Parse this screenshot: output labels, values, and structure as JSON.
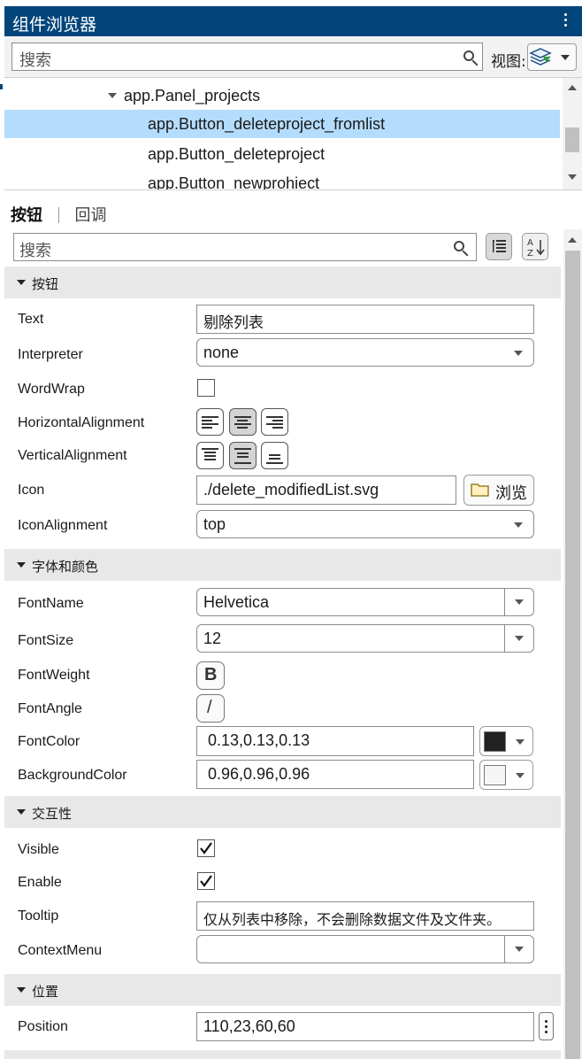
{
  "window": {
    "title": "组件浏览器"
  },
  "top_search": {
    "placeholder": "搜索"
  },
  "view": {
    "label": "视图:"
  },
  "tree": {
    "items": [
      {
        "label": "app.Panel_projects",
        "expanded": true
      },
      {
        "label": "app.Button_deleteproject_fromlist",
        "selected": true
      },
      {
        "label": "app.Button_deleteproject"
      },
      {
        "label": "app.Button_newprohiect"
      }
    ]
  },
  "inspector": {
    "tabs": [
      {
        "label": "按钮",
        "active": true
      },
      {
        "label": "回调",
        "active": false
      }
    ],
    "search_placeholder": "搜索",
    "sections": {
      "button": {
        "title": "按钮",
        "text": {
          "label": "Text",
          "value": "剔除列表"
        },
        "interpreter": {
          "label": "Interpreter",
          "value": "none"
        },
        "wordwrap": {
          "label": "WordWrap",
          "checked": false
        },
        "halign": {
          "label": "HorizontalAlignment",
          "value": "center"
        },
        "valign": {
          "label": "VerticalAlignment",
          "value": "center"
        },
        "icon": {
          "label": "Icon",
          "value": "./delete_modifiedList.svg",
          "browse": "浏览"
        },
        "iconalign": {
          "label": "IconAlignment",
          "value": "top"
        }
      },
      "font": {
        "title": "字体和颜色",
        "fontname": {
          "label": "FontName",
          "value": "Helvetica"
        },
        "fontsize": {
          "label": "FontSize",
          "value": "12"
        },
        "fontweight": {
          "label": "FontWeight",
          "glyph": "B"
        },
        "fontangle": {
          "label": "FontAngle",
          "glyph": "/"
        },
        "fontcolor": {
          "label": "FontColor",
          "value": "0.13,0.13,0.13",
          "swatch": "#212121"
        },
        "bgcolor": {
          "label": "BackgroundColor",
          "value": "0.96,0.96,0.96",
          "swatch": "#f5f5f5"
        }
      },
      "interact": {
        "title": "交互性",
        "visible": {
          "label": "Visible",
          "checked": true
        },
        "enable": {
          "label": "Enable",
          "checked": true
        },
        "tooltip": {
          "label": "Tooltip",
          "value": "仅从列表中移除，不会删除数据文件及文件夹。"
        },
        "contextmenu": {
          "label": "ContextMenu",
          "value": ""
        }
      },
      "position": {
        "title": "位置",
        "position": {
          "label": "Position",
          "value": "110,23,60,60"
        }
      }
    }
  },
  "colors": {
    "titlebar": "#02457a",
    "selection": "#b4dcfc",
    "section": "#e8e8e8"
  }
}
